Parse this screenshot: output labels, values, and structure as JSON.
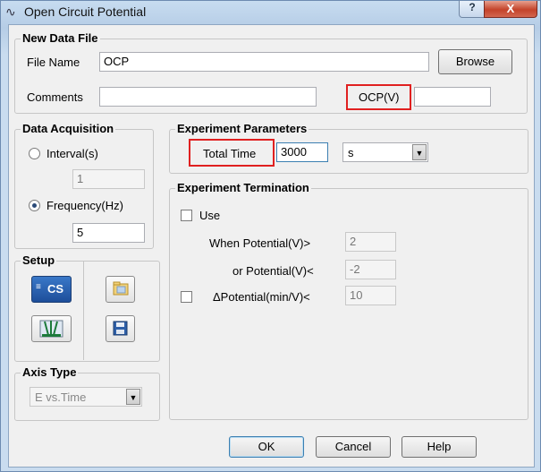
{
  "window": {
    "title": "Open Circuit Potential",
    "title_icon": "sine-wave-icon",
    "help_glyph": "?",
    "close_glyph": "X"
  },
  "new_data_file": {
    "title": "New Data File",
    "file_name_label": "File Name",
    "file_name_value": "OCP",
    "browse_label": "Browse",
    "comments_label": "Comments",
    "comments_value": "",
    "ocp_label": "OCP(V)",
    "ocp_value": ""
  },
  "data_acquisition": {
    "title": "Data Acquisition",
    "interval_label": "Interval(s)",
    "interval_value": "1",
    "interval_selected": false,
    "frequency_label": "Frequency(Hz)",
    "frequency_value": "5",
    "frequency_selected": true
  },
  "experiment_parameters": {
    "title": "Experiment Parameters",
    "total_time_label": "Total Time",
    "total_time_value": "3000",
    "unit_value": "s"
  },
  "experiment_termination": {
    "title": "Experiment Termination",
    "use_label": "Use",
    "use_checked": false,
    "when_potential_label": "When Potential(V)>",
    "when_potential_value": "2",
    "or_potential_label": "or Potential(V)<",
    "or_potential_value": "-2",
    "delta_checked": false,
    "delta_potential_label": "ΔPotential(min/V)<",
    "delta_potential_value": "10"
  },
  "setup": {
    "title": "Setup",
    "cs_label": "CS"
  },
  "axis_type": {
    "title": "Axis Type",
    "value": "E vs.Time"
  },
  "footer": {
    "ok_label": "OK",
    "cancel_label": "Cancel",
    "help_label": "Help"
  },
  "colors": {
    "highlight": "#e02020",
    "title_bar": "#c7dcf0",
    "dialog_bg": "#f0f0f0",
    "close_button": "#c4432a"
  }
}
